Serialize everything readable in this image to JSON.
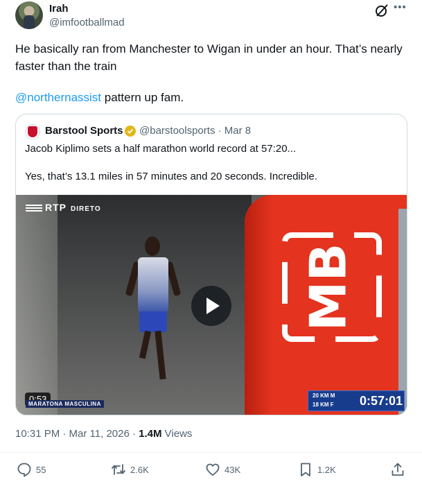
{
  "author": {
    "name": "Irah",
    "handle": "@imfootballmad"
  },
  "tweet": {
    "text": "He basically ran from Manchester to Wigan in under an hour. That’s nearly faster than the train",
    "mention": "@northernassist",
    "mention_suffix": " pattern up fam."
  },
  "quote": {
    "name": "Barstool Sports",
    "handle_date": "@barstoolsports · Mar 8",
    "line1": "Jacob Kiplimo sets a half marathon world record at 57:20...",
    "line2": "Yes, that’s 13.1 miles in 57 minutes and 20 seconds. Incredible.",
    "video": {
      "channel_logo": "RTP",
      "channel_status": "DIRETO",
      "banner_text": "MB",
      "duration": "0:53",
      "caption": "MARATONA MASCULINA",
      "scoreboard_km1": "20 KM  M",
      "scoreboard_km2": "18 KM  F",
      "scoreboard_time": "0:57:01"
    }
  },
  "meta": {
    "time_date": "10:31 PM · Mar 11, 2026 · ",
    "views_count": "1.4M",
    "views_label": " Views"
  },
  "actions": {
    "replies": "55",
    "reposts": "2.6K",
    "likes": "43K",
    "bookmarks": "1.2K"
  },
  "icons": [
    "grok-icon",
    "more-icon",
    "verified-icon",
    "play-icon",
    "reply-icon",
    "repost-icon",
    "like-icon",
    "bookmark-icon",
    "share-icon"
  ],
  "colors": {
    "link": "#1d9bf0",
    "secondary_text": "#536471",
    "verified_gold": "#e2b719",
    "banner_red": "#e4331f"
  }
}
